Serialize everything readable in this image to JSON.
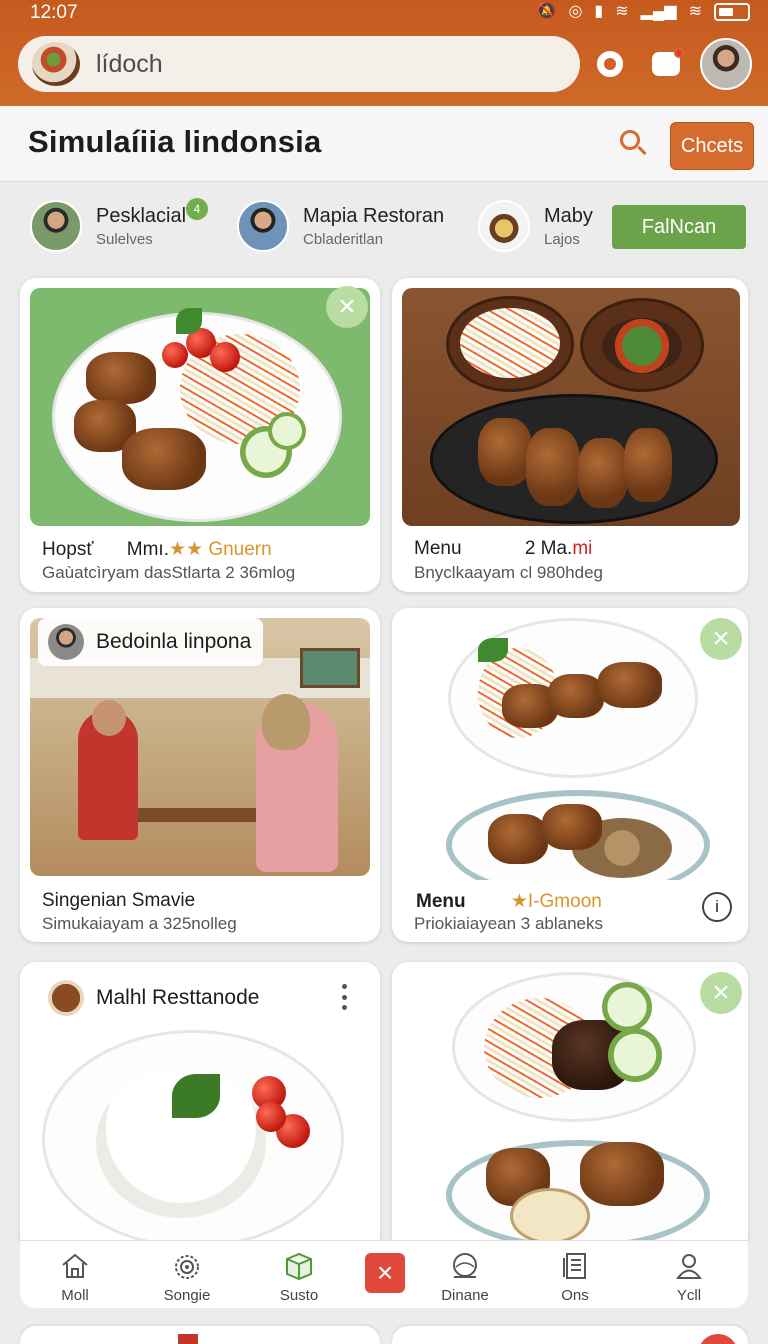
{
  "status_bar": {
    "time": "12:07"
  },
  "header": {
    "search_query": "lídoch"
  },
  "title_bar": {
    "title": "Simulaíiia lindonsia",
    "action_label": "Chcets"
  },
  "restaurants": [
    {
      "name": "Pesklacial",
      "sub": "Sulelves",
      "badge": "4"
    },
    {
      "name": "Mapia Restoran",
      "sub": "Cbladeritlan"
    },
    {
      "name": "Maby",
      "sub": "Lajos"
    }
  ],
  "follow_button": "FalNcan",
  "cards": [
    {
      "title": "Hopsť",
      "price": "Mmı.",
      "rating": "★★ Gnuern",
      "subtitle": "Gaùatcìryam dasStlarta 2 36mlog"
    },
    {
      "title": "Menu",
      "price_prefix": "2 Ma.",
      "price_suffix": "mi",
      "subtitle": "Bnyclkaayam cl 980hdeg"
    },
    {
      "pill": "Bedoinla linpona",
      "title": "Singenian Smavie",
      "subtitle": "Simukaiayam a 325nolleg"
    },
    {
      "title": "Menu",
      "rating": "★I-Gmoon",
      "subtitle": "Priokiaiayean 3 ablaneks",
      "info_icon": "i"
    },
    {
      "pill": "Malhl Resttanode"
    },
    {}
  ],
  "bottom_nav": [
    {
      "label": "Moll",
      "icon": "home-icon"
    },
    {
      "label": "Songie",
      "icon": "spiral-icon"
    },
    {
      "label": "Susto",
      "icon": "box-icon"
    },
    {
      "label": "Dinane",
      "icon": "globe-icon"
    },
    {
      "label": "Ons",
      "icon": "document-icon"
    },
    {
      "label": "Ycll",
      "icon": "user-icon"
    }
  ],
  "colors": {
    "accent": "#d56b2c",
    "green": "#6ba34b",
    "close_red": "#e0483c"
  }
}
